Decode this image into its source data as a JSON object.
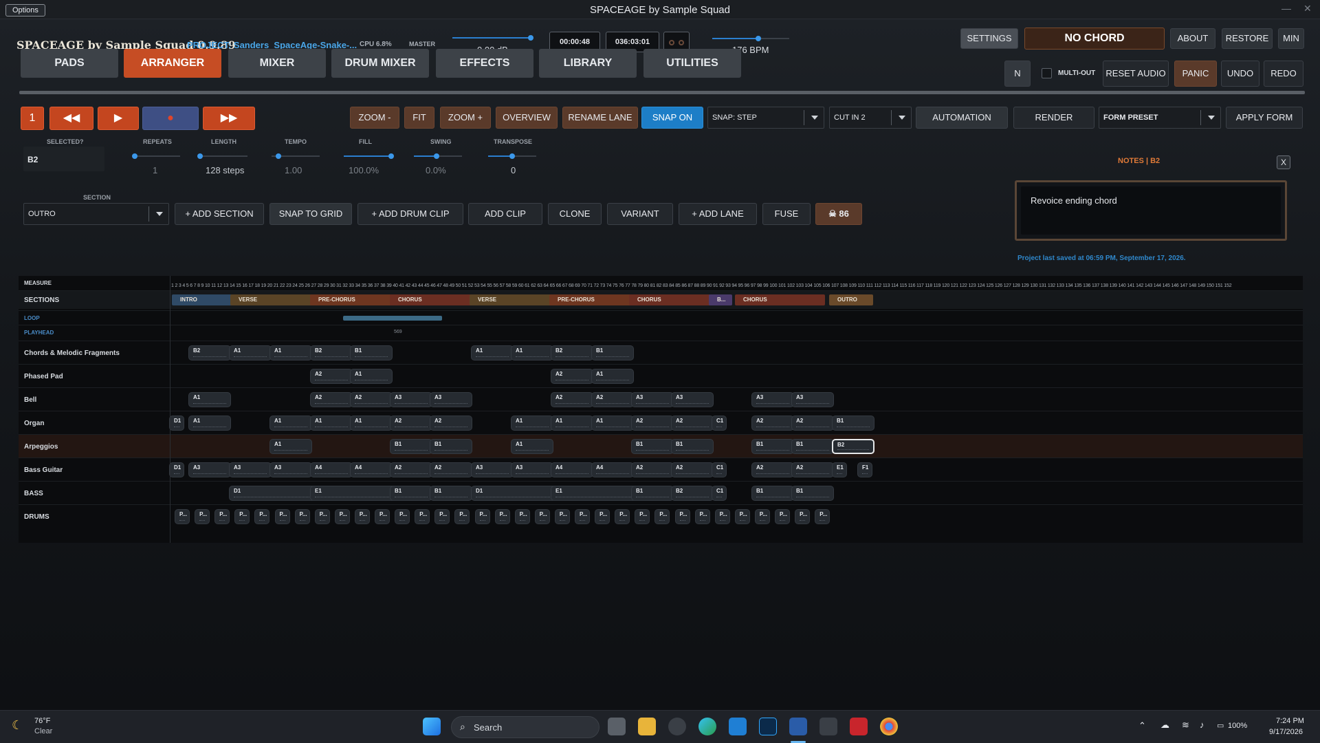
{
  "window": {
    "options_label": "Options",
    "title": "SPACEAGE by Sample Squad"
  },
  "header": {
    "app_title": "SPACEAGE by Sample Squad 0.9.89",
    "project": "PROJECT: Sanders_SpaceAge-Snake-...",
    "cpu": "CPU 6.8%",
    "master_label": "MASTER",
    "master_db": "0.00 dB",
    "master_level": 1.0,
    "time_elapsed": "00:00:48",
    "time_total": "036:03:01",
    "bpm": "176 BPM",
    "bpm_level": 0.6,
    "settings": "SETTINGS",
    "chord": "NO CHORD",
    "about": "ABOUT",
    "restore": "RESTORE",
    "min": "MIN"
  },
  "tabs": [
    "PADS",
    "ARRANGER",
    "MIXER",
    "DRUM MIXER",
    "EFFECTS",
    "LIBRARY",
    "UTILITIES"
  ],
  "right_controls": {
    "n": "N",
    "multi_out": "MULTI-OUT",
    "reset_audio": "RESET AUDIO",
    "panic": "PANIC",
    "undo": "UNDO",
    "redo": "REDO"
  },
  "transport": {
    "bar": "1",
    "rewind": "◀◀",
    "play": "▶",
    "record": "●",
    "ffwd": "▶▶"
  },
  "toolbar": {
    "zoom_minus": "ZOOM -",
    "fit": "FIT",
    "zoom_plus": "ZOOM +",
    "overview": "OVERVIEW",
    "rename_lane": "RENAME LANE",
    "snap_on": "SNAP ON",
    "snap_step": "SNAP: STEP",
    "cut_in": "CUT IN 2",
    "automation": "AUTOMATION",
    "render": "RENDER",
    "form_preset": "FORM PRESET",
    "apply_form": "APPLY FORM"
  },
  "params": {
    "selected_label": "SELECTED?",
    "selected_value": "B2",
    "repeats_label": "REPEATS",
    "repeats_value": "1",
    "length_label": "LENGTH",
    "length_value": "128 steps",
    "tempo_label": "TEMPO",
    "tempo_value": "1.00",
    "fill_label": "FILL",
    "fill_value": "100.0%",
    "swing_label": "SWING",
    "swing_value": "0.0%",
    "transpose_label": "TRANSPOSE",
    "transpose_value": "0"
  },
  "section_bar": {
    "section_label": "SECTION",
    "section_value": "OUTRO",
    "add_section": "+ ADD SECTION",
    "snap_to_grid": "SNAP TO GRID",
    "add_drum_clip": "+ ADD DRUM CLIP",
    "add_clip": "ADD CLIP",
    "clone": "CLONE",
    "variant": "VARIANT",
    "add_lane": "+ ADD LANE",
    "fuse": "FUSE",
    "counter": "86"
  },
  "notes": {
    "header": "NOTES | B2",
    "close": "X",
    "text": "Revoice ending chord",
    "saved": "Project last saved at 06:59 PM, September 17, 2026."
  },
  "grid": {
    "measure_label": "MEASURE",
    "sections_label": "SECTIONS",
    "loop_label": "LOOP",
    "playhead_label": "PLAYHEAD",
    "playhead_value": "569",
    "ticks": "1 2 3 4 5 6 7 8 9 10 11 12 13 14 15 16 17 18 19 20 21 22 23 24 25 26 27 28 29 30 31 32 33 34 35 36 37 38 39 40 41 42 43 44 45 46 47 48 49 50 51 52 53 54 55 56 57 58 59 60 61 62 63 64 65 66 67 68 69 70 71 72 73 74 75 76 77 78 79 80 81 82 83 84 85 86 87 88 89 90 91 92 93 94 95 96 97 98 99 100 101 102 103 104 105 106 107 108 109 110 111 112 113 114 115 116 117 118 119 120 121 122 123 124 125 126 127 128 129 130 131 132 133 134 135 136 137 138 139 140 141 142 143 144 145 146 147 148 149 150 151 152",
    "sections": [
      {
        "name": "INTRO",
        "color": "#2f4a66"
      },
      {
        "name": "VERSE",
        "color": "#5a4426"
      },
      {
        "name": "PRE-CHORUS",
        "color": "#6e3620"
      },
      {
        "name": "CHORUS",
        "color": "#6b2e22"
      },
      {
        "name": "VERSE",
        "color": "#5a4426"
      },
      {
        "name": "PRE-CHORUS",
        "color": "#6e3620"
      },
      {
        "name": "CHORUS",
        "color": "#6b2e22"
      },
      {
        "name": "B...",
        "color": "#4a3a6a"
      },
      {
        "name": "CHORUS",
        "color": "#6b2e22"
      },
      {
        "name": "OUTRO",
        "color": "#6a4a2a"
      }
    ],
    "lanes": [
      {
        "name": "Chords & Melodic Fragments",
        "clips": [
          "B2",
          "A1",
          "A1",
          "B2",
          "B1",
          "A1",
          "A1",
          "B2",
          "B1"
        ]
      },
      {
        "name": "Phased Pad",
        "clips": [
          "A2",
          "A1",
          "A2",
          "A1"
        ]
      },
      {
        "name": "Bell",
        "clips": [
          "A1",
          "A2",
          "A2",
          "A3",
          "A3",
          "A2",
          "A2",
          "A3",
          "A3",
          "A3",
          "A3"
        ]
      },
      {
        "name": "Organ",
        "clips": [
          "D1",
          "A1",
          "A1",
          "A1",
          "A1",
          "A2",
          "A2",
          "A1",
          "A1",
          "A1",
          "A2",
          "A2",
          "C1",
          "A2",
          "A2",
          "B1"
        ]
      },
      {
        "name": "Arpeggios",
        "clips": [
          "A1",
          "B1",
          "B1",
          "A1",
          "B1",
          "B1",
          "B1",
          "B1",
          "B2"
        ]
      },
      {
        "name": "Bass Guitar",
        "clips": [
          "D1",
          "A3",
          "A3",
          "A3",
          "A4",
          "A4",
          "A2",
          "A2",
          "A3",
          "A3",
          "A4",
          "A4",
          "A2",
          "A2",
          "C1",
          "A2",
          "A2",
          "E1",
          "F1"
        ]
      },
      {
        "name": "BASS",
        "clips": [
          "D1",
          "E1",
          "B1",
          "B1",
          "D1",
          "E1",
          "B1",
          "B2",
          "C1",
          "B1",
          "B1"
        ]
      },
      {
        "name": "DRUMS",
        "clips": [
          "P...",
          "P...",
          "P...",
          "P...",
          "P...",
          "P...",
          "P...",
          "P...",
          "P...",
          "P...",
          "P...",
          "P...",
          "P...",
          "P...",
          "P...",
          "P...",
          "P...",
          "P...",
          "P...",
          "P...",
          "P...",
          "P...",
          "P...",
          "P...",
          "P...",
          "P...",
          "P...",
          "P...",
          "P...",
          "P...",
          "P...",
          "P...",
          "P..."
        ]
      }
    ]
  },
  "taskbar": {
    "weather_temp": "76°F",
    "weather_desc": "Clear",
    "search": "Search",
    "battery": "100%",
    "time": "7:24 PM",
    "date": "9/17/2026"
  },
  "colors": {
    "accent_orange": "#c64d24",
    "accent_blue": "#1d7ec7",
    "bg": "#0d0f12"
  }
}
